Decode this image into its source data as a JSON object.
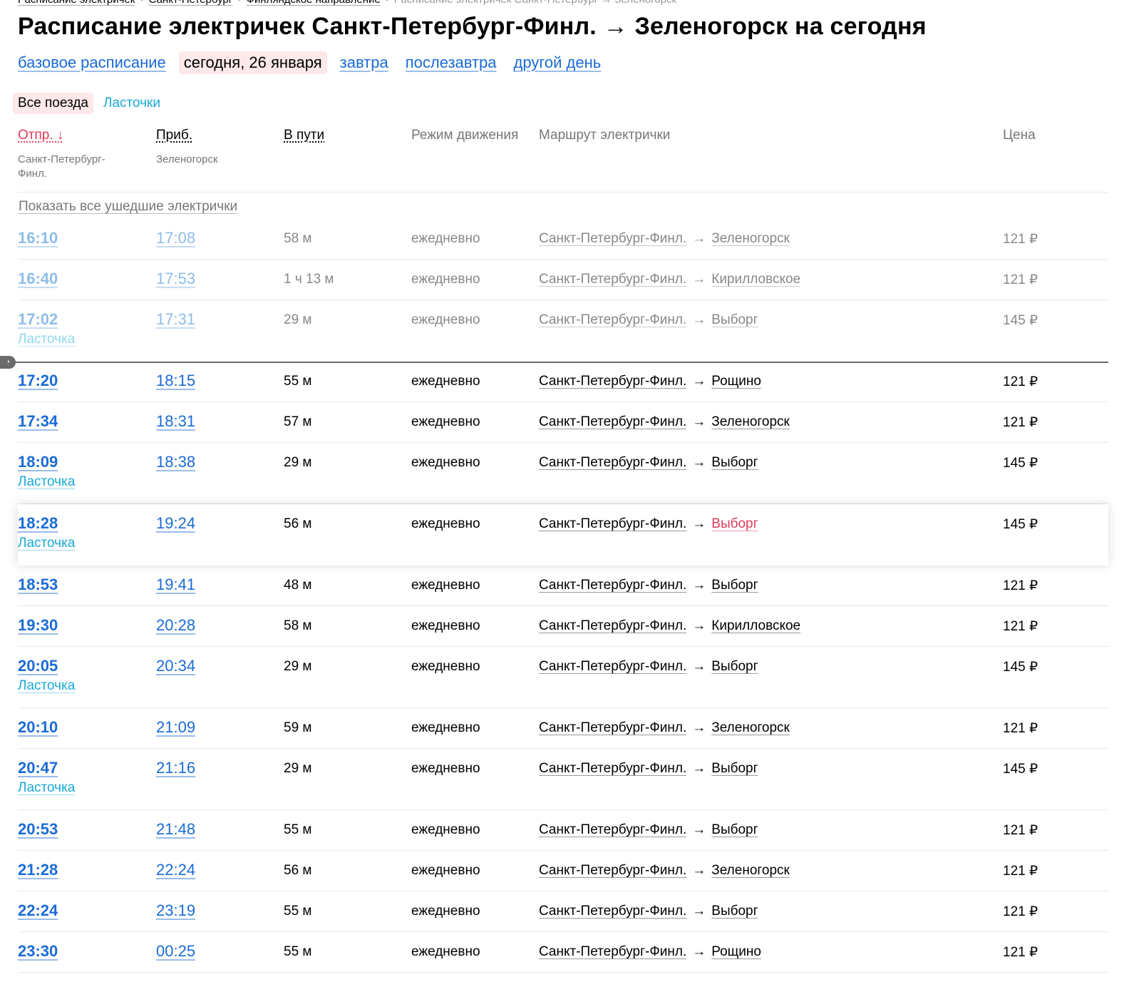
{
  "breadcrumb": {
    "items": [
      "Расписание электричек",
      "Санкт-Петербург",
      "Финляндское направление"
    ],
    "separator": "•",
    "current": "Расписание электричек Санкт-Петербург → Зеленогорск"
  },
  "title": "Расписание электричек Санкт-Петербург-Финл. → Зеленогорск на сегодня",
  "day_tabs": {
    "base": "базовое расписание",
    "today": "сегодня, 26 января",
    "tomorrow": "завтра",
    "after_tomorrow": "послезавтра",
    "other": "другой день"
  },
  "filters": {
    "all": "Все поезда",
    "lastochki": "Ласточки"
  },
  "columns": {
    "departure": "Отпр. ↓",
    "departure_station": "Санкт-Петербург-\nФинл.",
    "arrival": "Приб.",
    "arrival_station": "Зеленогорск",
    "duration": "В пути",
    "mode": "Режим движения",
    "route": "Маршрут электрички",
    "price": "Цена"
  },
  "show_all_departed": "Показать все ушедшие электрички",
  "colors": {
    "link": "#1a6bd6",
    "lastochka": "#1aa9d8",
    "accent_red": "#e23a5a",
    "active_bg": "#fde8ea"
  },
  "trains": [
    {
      "dep": "16:10",
      "arr": "17:08",
      "duration": "58 м",
      "mode": "ежедневно",
      "from": "Санкт-Петербург-Финл.",
      "arrow": "→",
      "to": "Зеленогорск",
      "price": "121 ₽",
      "past": true
    },
    {
      "dep": "16:40",
      "arr": "17:53",
      "duration": "1 ч 13 м",
      "mode": "ежедневно",
      "from": "Санкт-Петербург-Финл.",
      "arrow": "→",
      "to": "Кирилловское",
      "price": "121 ₽",
      "past": true
    },
    {
      "dep": "17:02",
      "arr": "17:31",
      "duration": "29 м",
      "mode": "ежедневно",
      "from": "Санкт-Петербург-Финл.",
      "arrow": "→",
      "to": "Выборг",
      "price": "145 ₽",
      "past": true,
      "type": "Ласточка"
    },
    {
      "dep": "17:20",
      "arr": "18:15",
      "duration": "55 м",
      "mode": "ежедневно",
      "from": "Санкт-Петербург-Финл.",
      "arrow": "→",
      "to": "Рощино",
      "price": "121 ₽"
    },
    {
      "dep": "17:34",
      "arr": "18:31",
      "duration": "57 м",
      "mode": "ежедневно",
      "from": "Санкт-Петербург-Финл.",
      "arrow": "→",
      "to": "Зеленогорск",
      "price": "121 ₽"
    },
    {
      "dep": "18:09",
      "arr": "18:38",
      "duration": "29 м",
      "mode": "ежедневно",
      "from": "Санкт-Петербург-Финл.",
      "arrow": "→",
      "to": "Выборг",
      "price": "145 ₽",
      "type": "Ласточка"
    },
    {
      "dep": "18:28",
      "arr": "19:24",
      "duration": "56 м",
      "mode": "ежедневно",
      "from": "Санкт-Петербург-Финл.",
      "arrow": "→",
      "to": "Выборг",
      "price": "145 ₽",
      "type": "Ласточка",
      "highlight": true
    },
    {
      "dep": "18:53",
      "arr": "19:41",
      "duration": "48 м",
      "mode": "ежедневно",
      "from": "Санкт-Петербург-Финл.",
      "arrow": "→",
      "to": "Выборг",
      "price": "121 ₽"
    },
    {
      "dep": "19:30",
      "arr": "20:28",
      "duration": "58 м",
      "mode": "ежедневно",
      "from": "Санкт-Петербург-Финл.",
      "arrow": "→",
      "to": "Кирилловское",
      "price": "121 ₽"
    },
    {
      "dep": "20:05",
      "arr": "20:34",
      "duration": "29 м",
      "mode": "ежедневно",
      "from": "Санкт-Петербург-Финл.",
      "arrow": "→",
      "to": "Выборг",
      "price": "145 ₽",
      "type": "Ласточка"
    },
    {
      "dep": "20:10",
      "arr": "21:09",
      "duration": "59 м",
      "mode": "ежедневно",
      "from": "Санкт-Петербург-Финл.",
      "arrow": "→",
      "to": "Зеленогорск",
      "price": "121 ₽"
    },
    {
      "dep": "20:47",
      "arr": "21:16",
      "duration": "29 м",
      "mode": "ежедневно",
      "from": "Санкт-Петербург-Финл.",
      "arrow": "→",
      "to": "Выборг",
      "price": "145 ₽",
      "type": "Ласточка"
    },
    {
      "dep": "20:53",
      "arr": "21:48",
      "duration": "55 м",
      "mode": "ежедневно",
      "from": "Санкт-Петербург-Финл.",
      "arrow": "→",
      "to": "Выборг",
      "price": "121 ₽"
    },
    {
      "dep": "21:28",
      "arr": "22:24",
      "duration": "56 м",
      "mode": "ежедневно",
      "from": "Санкт-Петербург-Финл.",
      "arrow": "→",
      "to": "Зеленогорск",
      "price": "121 ₽"
    },
    {
      "dep": "22:24",
      "arr": "23:19",
      "duration": "55 м",
      "mode": "ежедневно",
      "from": "Санкт-Петербург-Финл.",
      "arrow": "→",
      "to": "Выборг",
      "price": "121 ₽"
    },
    {
      "dep": "23:30",
      "arr": "00:25",
      "duration": "55 м",
      "mode": "ежедневно",
      "from": "Санкт-Петербург-Финл.",
      "arrow": "→",
      "to": "Рощино",
      "price": "121 ₽"
    }
  ]
}
